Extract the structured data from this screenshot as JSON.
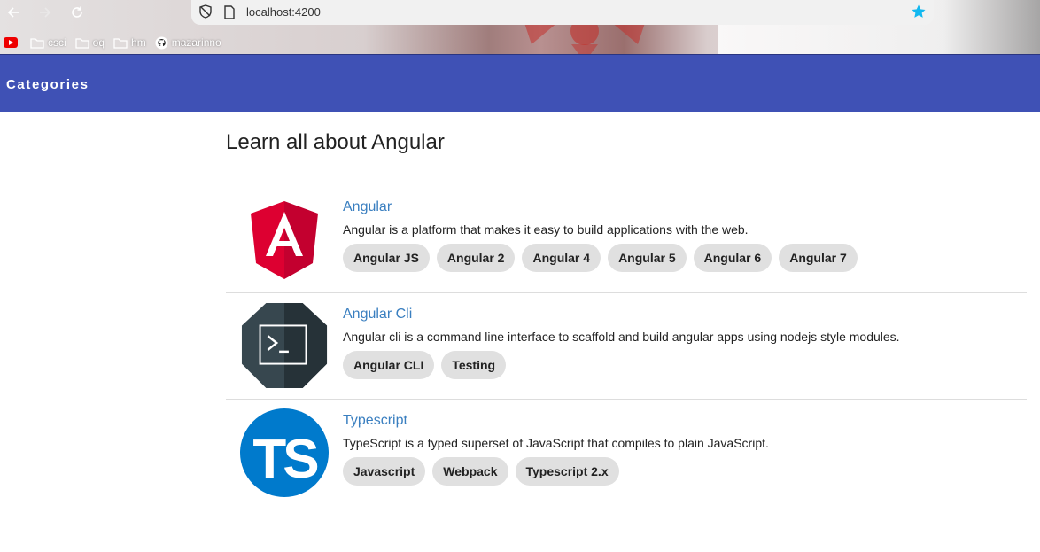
{
  "browser": {
    "url": "localhost:4200",
    "bookmarks": [
      {
        "label": "",
        "icon": "youtube-icon"
      },
      {
        "label": "csci",
        "icon": "folder-icon"
      },
      {
        "label": "oq",
        "icon": "folder-icon"
      },
      {
        "label": "hm",
        "icon": "folder-icon"
      },
      {
        "label": "mazarinno",
        "icon": "github-icon"
      }
    ]
  },
  "toolbar": {
    "title": "Categories",
    "color": "#3f51b5"
  },
  "main": {
    "heading": "Learn all about Angular",
    "items": [
      {
        "title": "Angular",
        "description": "Angular is a platform that makes it easy to build applications with the web.",
        "icon": "angular-logo-icon",
        "chips": [
          "Angular JS",
          "Angular 2",
          "Angular 4",
          "Angular 5",
          "Angular 6",
          "Angular 7"
        ]
      },
      {
        "title": "Angular Cli",
        "description": "Angular cli is a command line interface to scaffold and build angular apps using nodejs style modules.",
        "icon": "terminal-logo-icon",
        "chips": [
          "Angular CLI",
          "Testing"
        ]
      },
      {
        "title": "Typescript",
        "description": "TypeScript is a typed superset of JavaScript that compiles to plain JavaScript.",
        "icon": "typescript-logo-icon",
        "chips": [
          "Javascript",
          "Webpack",
          "Typescript 2.x"
        ]
      }
    ]
  },
  "colors": {
    "link": "#3a7fc0",
    "chip": "#e0e0e0",
    "angular": "#dd0031",
    "typescript": "#007acc"
  }
}
